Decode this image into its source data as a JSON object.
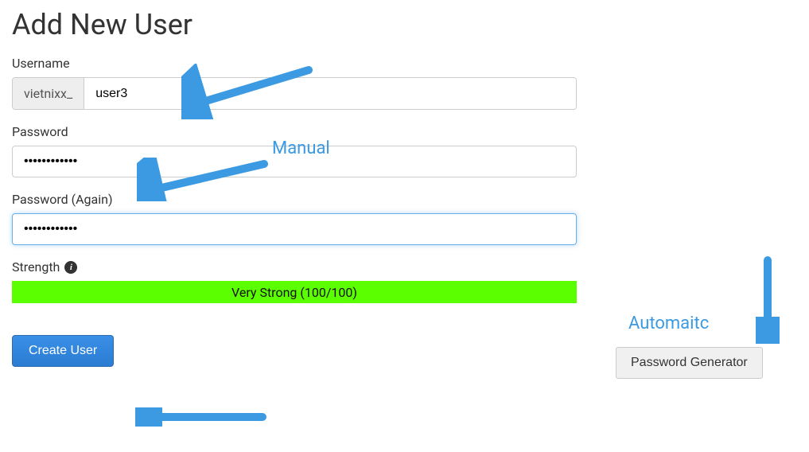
{
  "page": {
    "title": "Add New User"
  },
  "fields": {
    "username": {
      "label": "Username",
      "prefix": "vietnixx_",
      "value": "user3"
    },
    "password": {
      "label": "Password",
      "value": "••••••••••••"
    },
    "password_again": {
      "label": "Password (Again)",
      "value": "••••••••••••"
    }
  },
  "strength": {
    "label": "Strength",
    "text": "Very Strong (100/100)"
  },
  "buttons": {
    "create": "Create User",
    "generator": "Password Generator"
  },
  "annotations": {
    "manual": "Manual",
    "automatic": "Automaitc"
  }
}
